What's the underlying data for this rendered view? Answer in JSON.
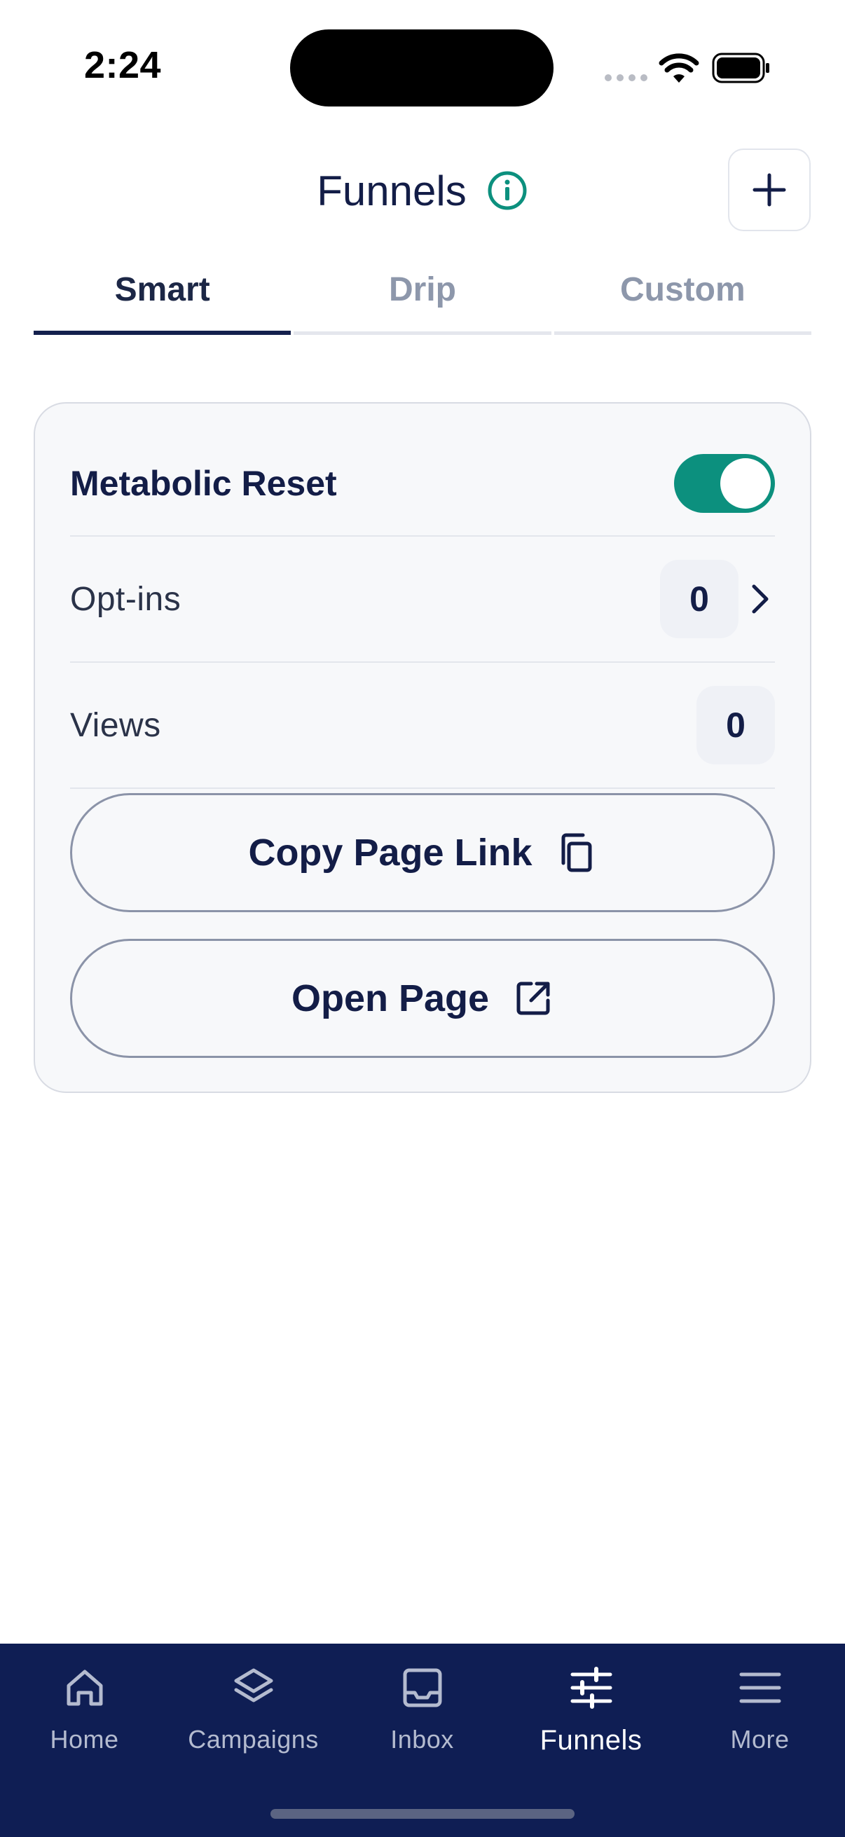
{
  "status_bar": {
    "time": "2:24"
  },
  "header": {
    "title": "Funnels"
  },
  "tabs": [
    {
      "label": "Smart",
      "active": true
    },
    {
      "label": "Drip",
      "active": false
    },
    {
      "label": "Custom",
      "active": false
    }
  ],
  "funnel_card": {
    "name": "Metabolic Reset",
    "enabled": true,
    "optins_label": "Opt-ins",
    "optins_value": "0",
    "views_label": "Views",
    "views_value": "0",
    "copy_link_label": "Copy Page Link",
    "open_page_label": "Open Page"
  },
  "bottom_nav": {
    "items": [
      {
        "label": "Home",
        "icon": "home-icon",
        "active": false
      },
      {
        "label": "Campaigns",
        "icon": "layers-icon",
        "active": false
      },
      {
        "label": "Inbox",
        "icon": "inbox-icon",
        "active": false
      },
      {
        "label": "Funnels",
        "icon": "sliders-icon",
        "active": true
      },
      {
        "label": "More",
        "icon": "menu-icon",
        "active": false
      }
    ]
  },
  "colors": {
    "navy": "#131d47",
    "nav_background": "#0f1e54",
    "accent_teal": "#0c907e",
    "inactive_tab": "#8d97ab"
  }
}
